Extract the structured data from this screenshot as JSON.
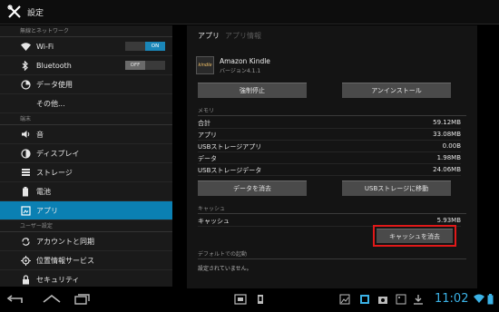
{
  "action_bar": {
    "title": "設定",
    "icon": "settings-tools-icon"
  },
  "sidebar": {
    "wireless_header": "無線とネットワーク",
    "wifi": {
      "label": "Wi-Fi",
      "toggle_on": "ON"
    },
    "bluetooth": {
      "label": "Bluetooth",
      "toggle_off": "OFF"
    },
    "data_usage": "データ使用",
    "more": "その他...",
    "device_header": "端末",
    "sound": "音",
    "display": "ディスプレイ",
    "storage": "ストレージ",
    "battery": "電池",
    "apps": "アプリ",
    "personal_header": "ユーザー設定",
    "accounts": "アカウントと同期",
    "location": "位置情報サービス",
    "security": "セキュリティ"
  },
  "panel": {
    "tab_app": "アプリ",
    "tab_app_info": "アプリ情報",
    "kindle_icon_text": "kindle",
    "app_name": "Amazon Kindle",
    "app_version": "バージョン4.1.1",
    "force_stop": "強制停止",
    "uninstall": "アンインストール",
    "storage_header": "メモリ",
    "storage_rows": [
      {
        "label": "合計",
        "value": "59.12MB"
      },
      {
        "label": "アプリ",
        "value": "33.08MB"
      },
      {
        "label": "USBストレージアプリ",
        "value": "0.00B"
      },
      {
        "label": "データ",
        "value": "1.98MB"
      },
      {
        "label": "USBストレージデータ",
        "value": "24.06MB"
      }
    ],
    "clear_data": "データを消去",
    "move_to_usb": "USBストレージに移動",
    "cache_header": "キャッシュ",
    "cache_row": {
      "label": "キャッシュ",
      "value": "5.93MB"
    },
    "clear_cache": "キャッシュを消去",
    "defaults_header": "デフォルトでの起動",
    "defaults_text": "設定されていません。"
  },
  "status_bar": {
    "time": "11:02"
  },
  "colors": {
    "accent": "#0b80b3",
    "highlight": "#e01919",
    "clock": "#3bb2e6"
  }
}
